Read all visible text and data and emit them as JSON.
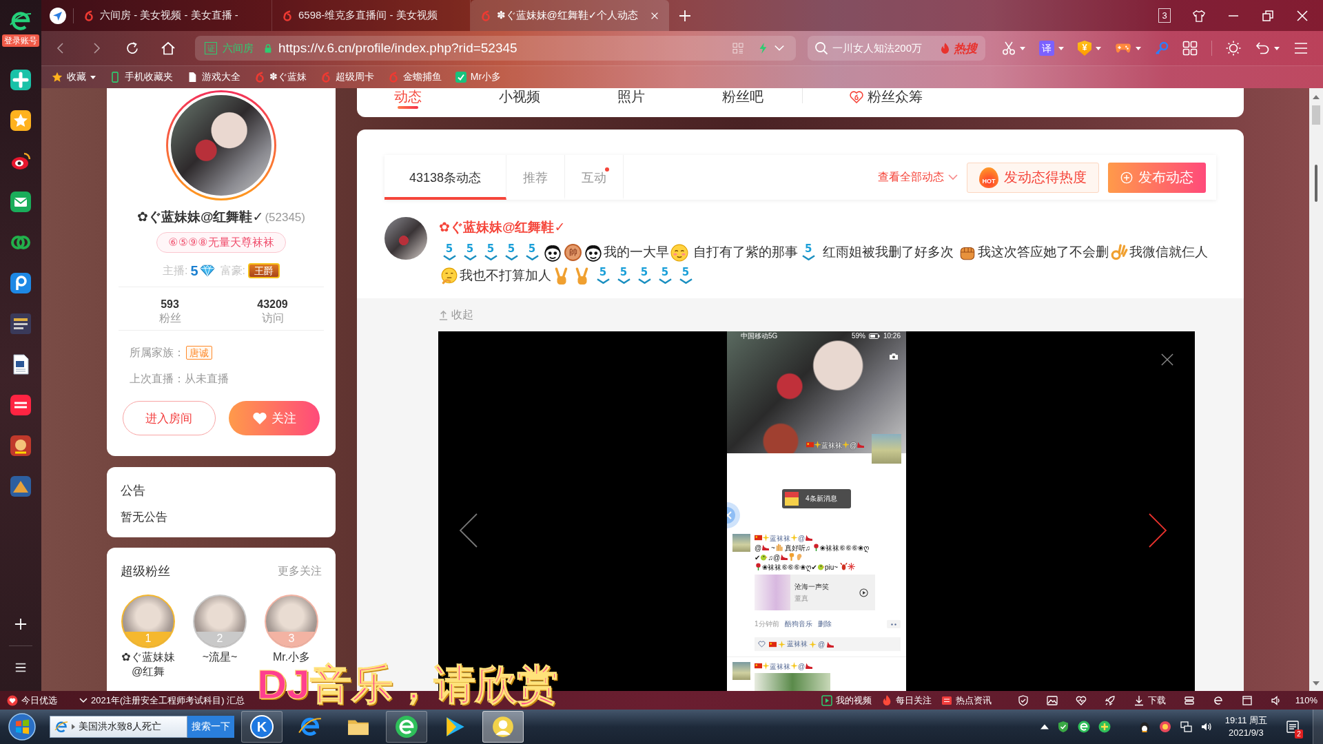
{
  "browser": {
    "login_label": "登录账号",
    "tabs": [
      {
        "title": "六间房 - 美女视频 - 美女直播 -",
        "selected": false
      },
      {
        "title": "6598-维克多直播间 - 美女视频",
        "selected": false
      },
      {
        "title": "✽ぐ蓝妹妹@红舞鞋✓个人动态",
        "selected": true
      }
    ],
    "window_count": "3",
    "address": {
      "cert": "证",
      "site": "六间房",
      "url": "https://v.6.cn/profile/index.php?rid=52345"
    },
    "search": {
      "value": "一川女人知法200万",
      "hot": "热搜"
    },
    "toolbar": {
      "translate": "译",
      "wallet": "¥"
    },
    "bookmarks": [
      {
        "kind": "star",
        "label": "收藏"
      },
      {
        "kind": "phone",
        "label": "手机收藏夹"
      },
      {
        "kind": "page",
        "label": "游戏大全"
      },
      {
        "kind": "six",
        "label": "✽ぐ蓝妹"
      },
      {
        "kind": "six",
        "label": "超级周卡"
      },
      {
        "kind": "six",
        "label": "金蟾捕鱼"
      },
      {
        "kind": "app",
        "label": "Mr小多"
      }
    ]
  },
  "profile": {
    "name": "✿ぐ蓝妹妹@红舞鞋✓",
    "room_id": "(52345)",
    "title_badge": "⑥⑤⑨⑧无量天尊袜袜",
    "anchor_label": "主播:",
    "anchor_level": "5",
    "rich_label": "富豪:",
    "rich_badge": "王爵",
    "stats": [
      {
        "value": "593",
        "label": "粉丝"
      },
      {
        "value": "43209",
        "label": "访问"
      }
    ],
    "family_label": "所属家族：",
    "family": "唐诚",
    "last_live": "上次直播：从未直播",
    "enter_button": "进入房间",
    "follow_button": "关注"
  },
  "notice": {
    "title": "公告",
    "text": "暂无公告"
  },
  "super_fans": {
    "title": "超级粉丝",
    "more": "更多关注",
    "fans": [
      {
        "rank": "1",
        "name": "✿ぐ蓝妹妹@红舞"
      },
      {
        "rank": "2",
        "name": "~流星~"
      },
      {
        "rank": "3",
        "name": "Mr.小多"
      }
    ]
  },
  "nav_tabs": [
    {
      "label": "动态",
      "selected": true,
      "kind": "plain"
    },
    {
      "label": "小视频",
      "selected": false,
      "kind": "plain"
    },
    {
      "label": "照片",
      "selected": false,
      "kind": "plain"
    },
    {
      "label": "粉丝吧",
      "selected": false,
      "kind": "plain"
    },
    {
      "label": "粉丝众筹",
      "selected": false,
      "kind": "crowdfund"
    }
  ],
  "feed": {
    "tabs": [
      {
        "label": "43138条动态",
        "selected": true,
        "unread": false
      },
      {
        "label": "推荐",
        "selected": false,
        "unread": false
      },
      {
        "label": "互动",
        "selected": false,
        "unread": true
      }
    ],
    "filter": "查看全部动态",
    "heat_badge": "HOT",
    "heat_button": "发动态得热度",
    "publish_button": "发布动态"
  },
  "post": {
    "author": "✿ぐ蓝妹妹@红舞鞋✓",
    "content": [
      {
        "kind": "level",
        "text": "5"
      },
      {
        "kind": "level",
        "text": "5"
      },
      {
        "kind": "level",
        "text": "5"
      },
      {
        "kind": "level",
        "text": "5"
      },
      {
        "kind": "level",
        "text": "5"
      },
      {
        "kind": "meme"
      },
      {
        "kind": "coin",
        "text": "帥"
      },
      {
        "kind": "meme"
      },
      {
        "kind": "text",
        "text": "我的一大早"
      },
      {
        "kind": "smile"
      },
      {
        "kind": "text",
        "text": " 自打有了紫的那事"
      },
      {
        "kind": "level",
        "text": "5"
      },
      {
        "kind": "text",
        "text": " 红雨姐被我删了好多次 "
      },
      {
        "kind": "fist"
      },
      {
        "kind": "text",
        "text": "我这次答应她了不会删"
      },
      {
        "kind": "ok"
      },
      {
        "kind": "text",
        "text": "我微信就仨人"
      },
      {
        "kind": "think"
      },
      {
        "kind": "text",
        "text": "我也不打算加人"
      },
      {
        "kind": "victory"
      },
      {
        "kind": "victory"
      },
      {
        "kind": "level",
        "text": "5"
      },
      {
        "kind": "level",
        "text": "5"
      },
      {
        "kind": "level",
        "text": "5"
      },
      {
        "kind": "level",
        "text": "5"
      },
      {
        "kind": "level",
        "text": "5"
      }
    ],
    "collapse": "收起"
  },
  "viewer": {
    "carrier": "中国移动5G",
    "battery": "59%",
    "time": "10:26",
    "cover_name": [
      {
        "kind": "flag"
      },
      {
        "kind": "sparkle"
      },
      {
        "kind": "text",
        "text": "蓝袜袜"
      },
      {
        "kind": "sparkle"
      },
      {
        "kind": "text",
        "text": "@"
      },
      {
        "kind": "shoe"
      }
    ],
    "new_messages": "4条新消息",
    "posts": [
      {
        "name": [
          {
            "kind": "flag"
          },
          {
            "kind": "sparkle"
          },
          {
            "kind": "text",
            "text": "蓝袜袜"
          },
          {
            "kind": "sparkle"
          },
          {
            "kind": "text",
            "text": "@"
          },
          {
            "kind": "shoe"
          }
        ],
        "lines": [
          [
            {
              "kind": "text",
              "text": "@"
            },
            {
              "kind": "shoe"
            },
            {
              "kind": "text",
              "text": " ~"
            },
            {
              "kind": "hand"
            },
            {
              "kind": "text",
              "text": " 真好听♫ "
            },
            {
              "kind": "rose"
            },
            {
              "kind": "text",
              "text": "❀袜袜⑥⑥⑥❀ღ"
            }
          ],
          [
            {
              "kind": "text",
              "text": "✔"
            },
            {
              "kind": "chick"
            },
            {
              "kind": "text",
              "text": "♫@"
            },
            {
              "kind": "shoe"
            },
            {
              "kind": "point"
            },
            {
              "kind": "ear"
            }
          ],
          [
            {
              "kind": "rose"
            },
            {
              "kind": "text",
              "text": "❀袜袜⑥⑥⑥❀ღ✔"
            },
            {
              "kind": "chick"
            },
            {
              "kind": "text",
              "text": "piu~ "
            },
            {
              "kind": "lobster"
            },
            {
              "kind": "firework"
            }
          ]
        ],
        "music": {
          "title": "沧海一声笑",
          "artist": "董真"
        },
        "time": "1分钟前",
        "source": "酷狗音乐",
        "delete": "删除",
        "likes": [
          {
            "kind": "flag"
          },
          {
            "kind": "sparkle"
          },
          {
            "kind": "text",
            "text": "蓝袜袜"
          },
          {
            "kind": "sparkle"
          },
          {
            "kind": "text",
            "text": "@"
          },
          {
            "kind": "shoe"
          }
        ],
        "photo": false
      },
      {
        "name": [
          {
            "kind": "flag"
          },
          {
            "kind": "sparkle"
          },
          {
            "kind": "text",
            "text": "蓝袜袜"
          },
          {
            "kind": "sparkle"
          },
          {
            "kind": "text",
            "text": "@"
          },
          {
            "kind": "shoe"
          }
        ],
        "photo": true
      }
    ]
  },
  "status_bar": {
    "left": [
      {
        "kind": "heart",
        "label": "今日优选"
      },
      {
        "kind": "dropdown",
        "label": "2021年(注册安全工程师考试科目) 汇总"
      }
    ],
    "right": [
      {
        "kind": "video",
        "label": "我的视频"
      },
      {
        "kind": "fire",
        "label": "每日关注"
      },
      {
        "kind": "news",
        "label": "热点资讯"
      }
    ],
    "download": "下载",
    "zoom": "110%"
  },
  "taskbar": {
    "search_value": "美国洪水致8人死亡",
    "search_button": "搜索一下",
    "apps": [
      {
        "kind": "letter",
        "label": "K",
        "running": true,
        "selected": false
      },
      {
        "kind": "ie",
        "running": false,
        "selected": false
      },
      {
        "kind": "folder",
        "running": false,
        "selected": false
      },
      {
        "kind": "browser",
        "running": true,
        "selected": false
      },
      {
        "kind": "player",
        "running": false,
        "selected": false
      },
      {
        "kind": "avatar",
        "running": true,
        "selected": true
      }
    ],
    "time": "19:11 周五",
    "date": "2021/9/3",
    "notifications": "2"
  },
  "lyrics_overlay": "DJ音乐，请欣赏"
}
